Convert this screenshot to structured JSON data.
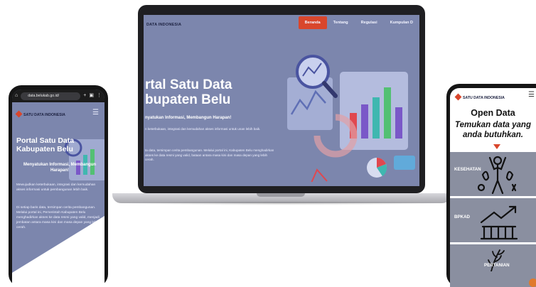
{
  "laptop": {
    "brand": "DATA INDONESIA",
    "menu": [
      {
        "label": "Beranda",
        "active": true
      },
      {
        "label": "Tentang",
        "active": false
      },
      {
        "label": "Regulasi",
        "active": false
      },
      {
        "label": "Kumpulan D",
        "active": false
      }
    ],
    "hero_title_line1": "rtal Satu Data",
    "hero_title_line2": "bupaten Belu",
    "tagline": "nyatukan Informasi, Membangun Harapan!",
    "paragraph1": "n keterbukaan, integrasi dan kemudahan akses informasi untuk unan lebih baik.",
    "paragraph2": "ta data, tersimpan cerita pembangunan. Melalui portal ini, Kabupaten Belu menghadirkan akses ke data resmi yang valid, bataan antara masa kini dan masa depan yang lebih cerah."
  },
  "phone_left": {
    "url": "data.belukab.go.id/",
    "brand": "SATU DATA INDONESIA",
    "hero_title": "Portal Satu Data Kabupaten Belu",
    "tagline": "Menyatukan Informasi, Membangun Harapan!",
    "paragraph1": "Mewujudkan keterbukaan, integrasi dan kemudahan akses informasi untuk pembangunan lebih baik.",
    "paragraph2": "Di setiap baris data, tersimpan cerita pembangunan. Melalui portal ini, Pemerintah Kabupaten Belu menghadirkan akses ke data resmi yang valid, menjadi jembatan antara masa kini dan masa depan yang lebih cerah."
  },
  "phone_right": {
    "brand": "SATU DATA INDONESIA",
    "title": "Open Data",
    "subtitle_line1": "Temukan data yang",
    "subtitle_line2": "anda butuhkan.",
    "categories": [
      "KESEHATAN",
      "BPKAD",
      "PERTANIAN"
    ]
  },
  "icons": {
    "phone_left_status": [
      "home-icon",
      "tabs-icon",
      "plus-icon",
      "refresh-icon",
      "more-icon"
    ],
    "menu": "hamburger-icon"
  },
  "colors": {
    "accent": "#d9462c",
    "overlay": "#7c86ad",
    "card": "#8a8fa0"
  }
}
